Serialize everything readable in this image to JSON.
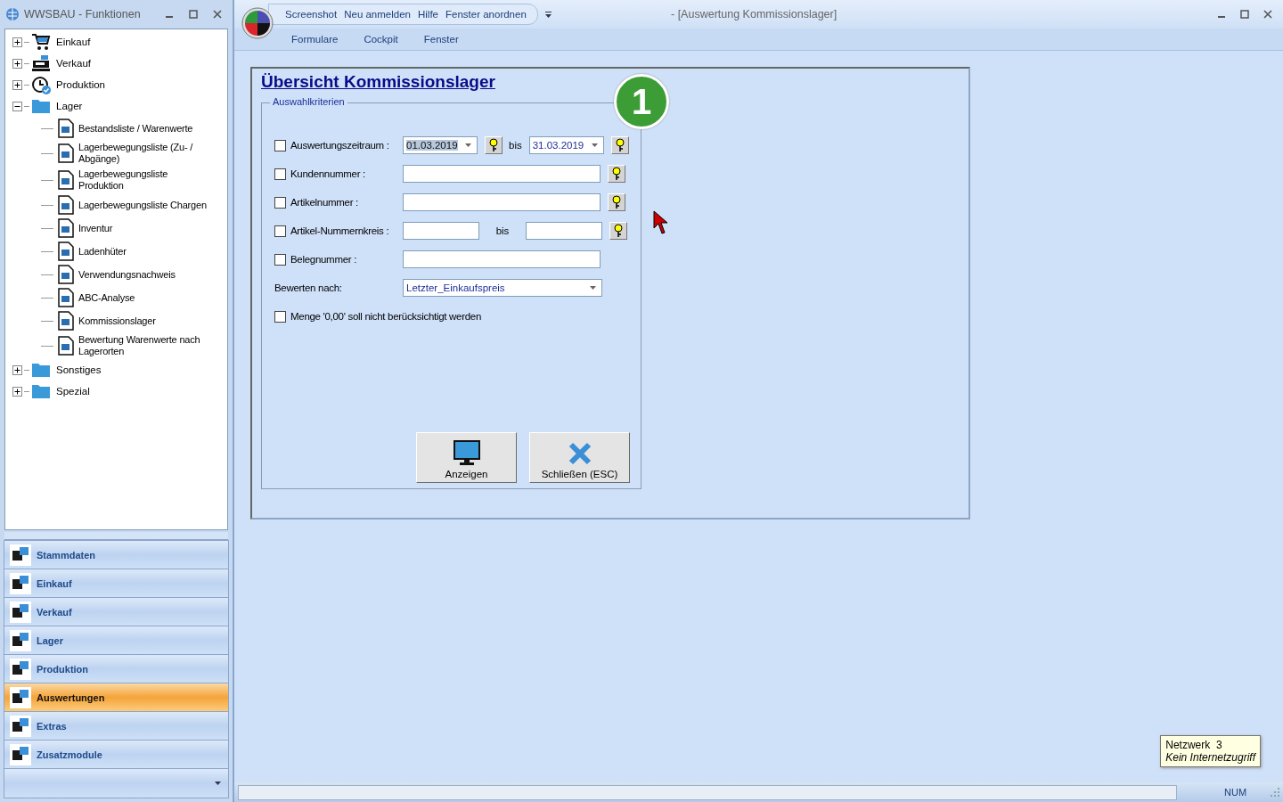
{
  "functions_window": {
    "title": "WWSBAU - Funktionen",
    "tree": [
      {
        "label": "Einkauf",
        "kind": "cart",
        "expanded": false
      },
      {
        "label": "Verkauf",
        "kind": "register",
        "expanded": false
      },
      {
        "label": "Produktion",
        "kind": "clock",
        "expanded": false
      },
      {
        "label": "Lager",
        "kind": "folder",
        "expanded": true,
        "children": [
          {
            "label": "Bestandsliste / Warenwerte"
          },
          {
            "label": "Lagerbewegungsliste (Zu- / Abgänge)"
          },
          {
            "label": "Lagerbewegungsliste Produktion"
          },
          {
            "label": "Lagerbewegungsliste Chargen"
          },
          {
            "label": "Inventur"
          },
          {
            "label": "Ladenhüter"
          },
          {
            "label": "Verwendungsnachweis"
          },
          {
            "label": "ABC-Analyse"
          },
          {
            "label": "Kommissionslager"
          },
          {
            "label": "Bewertung Warenwerte nach Lagerorten"
          }
        ]
      },
      {
        "label": "Sonstiges",
        "kind": "folder",
        "expanded": false
      },
      {
        "label": "Spezial",
        "kind": "folder",
        "expanded": false
      }
    ],
    "nav": [
      {
        "label": "Stammdaten",
        "selected": false
      },
      {
        "label": "Einkauf",
        "selected": false
      },
      {
        "label": "Verkauf",
        "selected": false
      },
      {
        "label": "Lager",
        "selected": false
      },
      {
        "label": "Produktion",
        "selected": false
      },
      {
        "label": "Auswertungen",
        "selected": true
      },
      {
        "label": "Extras",
        "selected": false
      },
      {
        "label": "Zusatzmodule",
        "selected": false
      }
    ]
  },
  "main_window": {
    "title": "- [Auswertung Kommissionslager]",
    "quick_access": [
      "Screenshot",
      "Neu anmelden",
      "Hilfe",
      "Fenster anordnen"
    ],
    "menu": [
      "Formulare",
      "Cockpit",
      "Fenster"
    ],
    "form": {
      "title": "Übersicht Kommissionslager",
      "group_label": "Auswahlkriterien",
      "badge": "1",
      "rows": [
        {
          "kind": "date_range",
          "label": "Auswertungszeitraum :",
          "checked": false,
          "from": "01.03.2019",
          "separator": "bis",
          "to": "31.03.2019"
        },
        {
          "kind": "text",
          "label": "Kundennummer :",
          "checked": false,
          "help": true
        },
        {
          "kind": "text",
          "label": "Artikelnummer :",
          "checked": false,
          "help": true
        },
        {
          "kind": "text_range",
          "label": "Artikel-Nummernkreis :",
          "checked": false,
          "separator": "bis",
          "help": true
        },
        {
          "kind": "text",
          "label": "Belegnummer :",
          "checked": false,
          "help": false
        },
        {
          "kind": "select",
          "label": "Bewerten nach:",
          "value": "Letzter_Einkaufspreis"
        },
        {
          "kind": "check",
          "label": "Menge '0,00' soll nicht berücksichtigt werden",
          "checked": false
        }
      ],
      "buttons": [
        {
          "label": "Anzeigen",
          "kind": "monitor"
        },
        {
          "label": "Schließen (ESC)",
          "kind": "close"
        }
      ]
    },
    "status_bar": {
      "indicator": "NUM"
    },
    "tooltip": {
      "title": "Netzwerk  3",
      "subtitle": "Kein Internetzugriff"
    }
  }
}
